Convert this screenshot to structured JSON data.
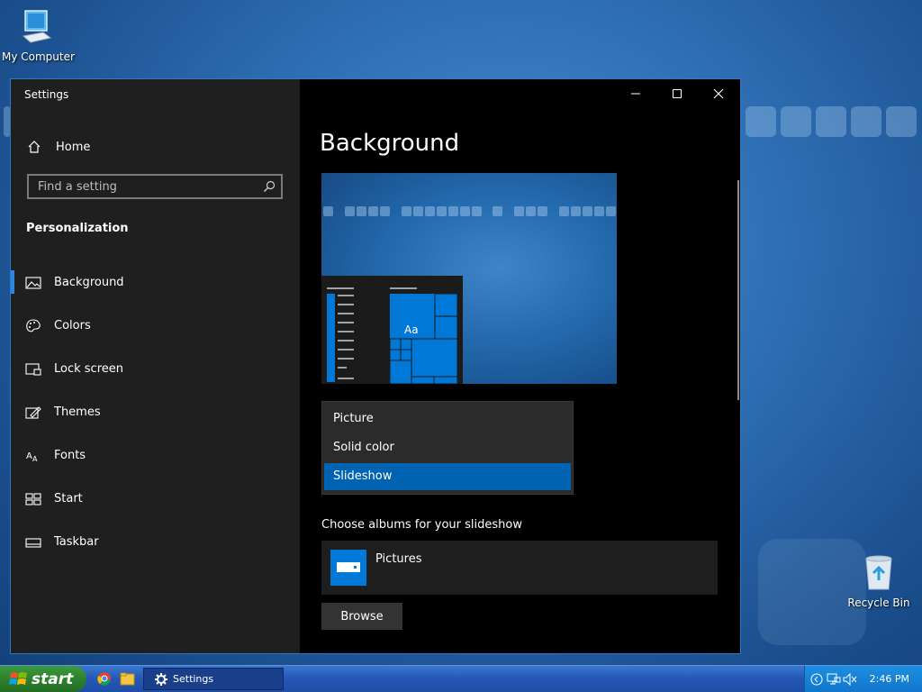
{
  "desktop": {
    "icons": {
      "my_computer": "My Computer",
      "recycle_bin": "Recycle Bin"
    }
  },
  "window": {
    "title": "Settings",
    "controls": {
      "minimize": "minimize-icon",
      "maximize": "maximize-icon",
      "close": "close-icon"
    }
  },
  "sidebar": {
    "home_label": "Home",
    "search_placeholder": "Find a setting",
    "section_title": "Personalization",
    "items": [
      {
        "label": "Background",
        "icon": "picture-icon",
        "active": true
      },
      {
        "label": "Colors",
        "icon": "palette-icon"
      },
      {
        "label": "Lock screen",
        "icon": "lock-screen-icon"
      },
      {
        "label": "Themes",
        "icon": "themes-icon"
      },
      {
        "label": "Fonts",
        "icon": "fonts-icon"
      },
      {
        "label": "Start",
        "icon": "start-icon"
      },
      {
        "label": "Taskbar",
        "icon": "taskbar-icon"
      }
    ]
  },
  "main": {
    "title": "Background",
    "preview_tile_label": "Aa",
    "background_options": [
      "Picture",
      "Solid color",
      "Slideshow"
    ],
    "selected_option": "Slideshow",
    "albums_label": "Choose albums for your slideshow",
    "album_name": "Pictures",
    "browse_label": "Browse"
  },
  "taskbar": {
    "start_label": "start",
    "task_label": "Settings",
    "clock": "2:46 PM"
  },
  "colors": {
    "accent": "#0078d7",
    "selected_option": "#0063b1",
    "sidebar_bg": "#1f1f1f"
  }
}
